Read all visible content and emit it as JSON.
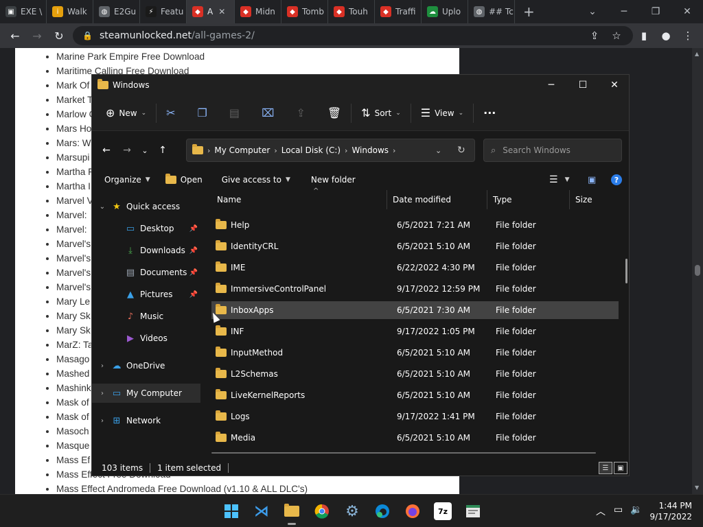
{
  "browser": {
    "tabs": [
      {
        "label": "EXE \\",
        "color": "#3c4043",
        "glyph": "▣"
      },
      {
        "label": "Walk",
        "color": "#e5a00d",
        "glyph": "i"
      },
      {
        "label": "E2Gu",
        "color": "#5f6368",
        "glyph": "◍"
      },
      {
        "label": "Featu",
        "color": "#1a1a1a",
        "glyph": "⚡"
      },
      {
        "label": "A",
        "color": "#d93025",
        "glyph": "◆"
      },
      {
        "label": "Midn",
        "color": "#d93025",
        "glyph": "◆"
      },
      {
        "label": "Tomb",
        "color": "#d93025",
        "glyph": "◆"
      },
      {
        "label": "Touh",
        "color": "#d93025",
        "glyph": "◆"
      },
      {
        "label": "Traffi",
        "color": "#d93025",
        "glyph": "◆"
      },
      {
        "label": "Uplo",
        "color": "#1e8e3e",
        "glyph": "☁"
      },
      {
        "label": "## Tc",
        "color": "#5f6368",
        "glyph": "◍"
      }
    ],
    "url_domain": "steamunlocked.net",
    "url_path": "/all-games-2/"
  },
  "page_list": [
    "Marine Park Empire Free Download",
    "Maritime Calling Free Download",
    "Mark Of",
    "Market T",
    "Marlow C",
    "Mars Ho",
    "Mars: W",
    "Marsupi",
    "Martha F",
    "Martha I",
    "Marvel V",
    "Marvel:",
    "Marvel:",
    "Marvel's",
    "Marvel's",
    "Marvel's",
    "Marvel's",
    "Mary Le",
    "Mary Sk",
    "Mary Sk",
    "MarZ: Ta",
    "Masago",
    "Mashed",
    "Mashink",
    "Mask of",
    "Mask of",
    "Masoch",
    "Masque",
    "Mass Ef",
    "Mass Effect Free Download",
    "Mass Effect Andromeda Free Download (v1.10 & ALL DLC's)"
  ],
  "explorer": {
    "title": "Windows",
    "cmd": {
      "new": "New",
      "sort": "Sort",
      "view": "View",
      "more": "···"
    },
    "breadcrumb": [
      "My Computer",
      "Local Disk (C:)",
      "Windows"
    ],
    "search_placeholder": "Search Windows",
    "tools": {
      "organize": "Organize",
      "open": "Open",
      "give_access": "Give access to",
      "new_folder": "New folder"
    },
    "nav": [
      {
        "label": "Quick access",
        "glyph": "★",
        "color": "#f2c811",
        "expand": "⌄",
        "pin": false
      },
      {
        "label": "Desktop",
        "glyph": "▭",
        "color": "#3aa0e8",
        "pin": true
      },
      {
        "label": "Downloads",
        "glyph": "⤓",
        "color": "#4caf50",
        "pin": true
      },
      {
        "label": "Documents",
        "glyph": "▤",
        "color": "#9aa4b0",
        "pin": true
      },
      {
        "label": "Pictures",
        "glyph": "▲",
        "color": "#3aa0e8",
        "pin": true
      },
      {
        "label": "Music",
        "glyph": "♪",
        "color": "#e36c5a",
        "pin": false
      },
      {
        "label": "Videos",
        "glyph": "▶",
        "color": "#9b59d0",
        "pin": false
      },
      {
        "label": "OneDrive",
        "glyph": "☁",
        "color": "#3aa0e8",
        "expand": "›",
        "pin": false
      },
      {
        "label": "My Computer",
        "glyph": "▭",
        "color": "#3aa0e8",
        "expand": "›",
        "pin": false
      },
      {
        "label": "Network",
        "glyph": "⊞",
        "color": "#3aa0e8",
        "expand": "›",
        "pin": false
      }
    ],
    "columns": {
      "name": "Name",
      "date": "Date modified",
      "type": "Type",
      "size": "Size"
    },
    "rows": [
      {
        "name": "Help",
        "date": "6/5/2021 7:21 AM",
        "type": "File folder"
      },
      {
        "name": "IdentityCRL",
        "date": "6/5/2021 5:10 AM",
        "type": "File folder"
      },
      {
        "name": "IME",
        "date": "6/22/2022 4:30 PM",
        "type": "File folder"
      },
      {
        "name": "ImmersiveControlPanel",
        "date": "9/17/2022 12:59 PM",
        "type": "File folder"
      },
      {
        "name": "InboxApps",
        "date": "6/5/2021 7:30 AM",
        "type": "File folder"
      },
      {
        "name": "INF",
        "date": "9/17/2022 1:05 PM",
        "type": "File folder"
      },
      {
        "name": "InputMethod",
        "date": "6/5/2021 5:10 AM",
        "type": "File folder"
      },
      {
        "name": "L2Schemas",
        "date": "6/5/2021 5:10 AM",
        "type": "File folder"
      },
      {
        "name": "LiveKernelReports",
        "date": "6/5/2021 5:10 AM",
        "type": "File folder"
      },
      {
        "name": "Logs",
        "date": "9/17/2022 1:41 PM",
        "type": "File folder"
      },
      {
        "name": "Media",
        "date": "6/5/2021 5:10 AM",
        "type": "File folder"
      }
    ],
    "status": {
      "items": "103 items",
      "selected": "1 item selected"
    }
  },
  "clock": {
    "time": "1:44 PM",
    "date": "9/17/2022"
  }
}
